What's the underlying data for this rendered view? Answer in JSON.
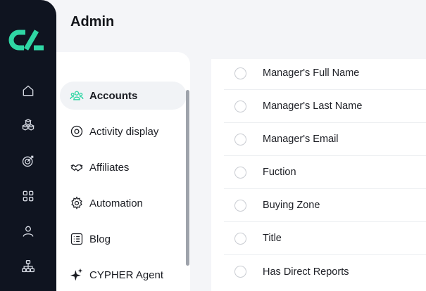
{
  "page": {
    "title": "Admin"
  },
  "rail": {
    "icons": [
      {
        "name": "home-icon"
      },
      {
        "name": "boxes-icon"
      },
      {
        "name": "target-icon"
      },
      {
        "name": "grid-icon"
      },
      {
        "name": "user-icon"
      },
      {
        "name": "org-chart-icon"
      }
    ],
    "accent_color": "#2fd6a4"
  },
  "menu": {
    "items": [
      {
        "label": "Accounts",
        "icon": "users-icon",
        "active": true
      },
      {
        "label": "Activity display",
        "icon": "target-circle-icon"
      },
      {
        "label": "Affiliates",
        "icon": "handshake-icon"
      },
      {
        "label": "Automation",
        "icon": "gear-icon"
      },
      {
        "label": "Blog",
        "icon": "list-icon"
      },
      {
        "label": "CYPHER Agent",
        "icon": "sparkle-icon"
      }
    ]
  },
  "fields": {
    "items": [
      {
        "label": "Manager's Full Name"
      },
      {
        "label": "Manager's Last Name"
      },
      {
        "label": "Manager's Email"
      },
      {
        "label": "Fuction"
      },
      {
        "label": "Buying Zone"
      },
      {
        "label": "Title"
      },
      {
        "label": "Has Direct Reports"
      }
    ]
  }
}
